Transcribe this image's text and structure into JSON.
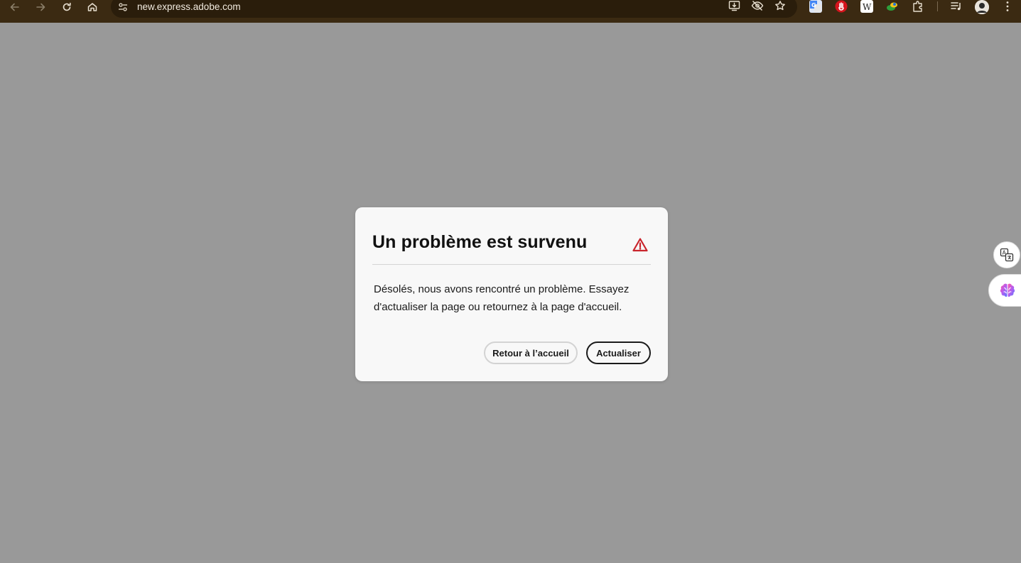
{
  "browser": {
    "url": "new.express.adobe.com",
    "toolbar_icons": [
      "back-icon",
      "forward-icon",
      "reload-icon",
      "home-icon",
      "site-settings-icon",
      "install-app-icon",
      "tracking-protection-icon",
      "bookmark-star-icon"
    ],
    "extensions": [
      "google-translate-extension-icon",
      "red-hand-extension-icon",
      "w-extension-icon",
      "green-leaf-extension-icon",
      "puzzle-extensions-icon",
      "media-controls-icon",
      "profile-avatar",
      "menu-kebab-icon"
    ]
  },
  "dialog": {
    "title": "Un problème est survenu",
    "body": "Désolés, nous avons rencontré un problème. Essayez d'actualiser la page ou retournez à la page d'accueil.",
    "secondary_button": "Retour à l’accueil",
    "primary_button": "Actualiser",
    "alert_icon": "alert-triangle-icon",
    "alert_color": "#c9252d"
  },
  "colors": {
    "backdrop": "#999999",
    "toolbar": "#3b2a12",
    "omnibox": "#2a1d0b",
    "dialog_bg": "#f8f8f8"
  },
  "side_widgets": [
    "translate-icon",
    "brain-ai-icon"
  ]
}
